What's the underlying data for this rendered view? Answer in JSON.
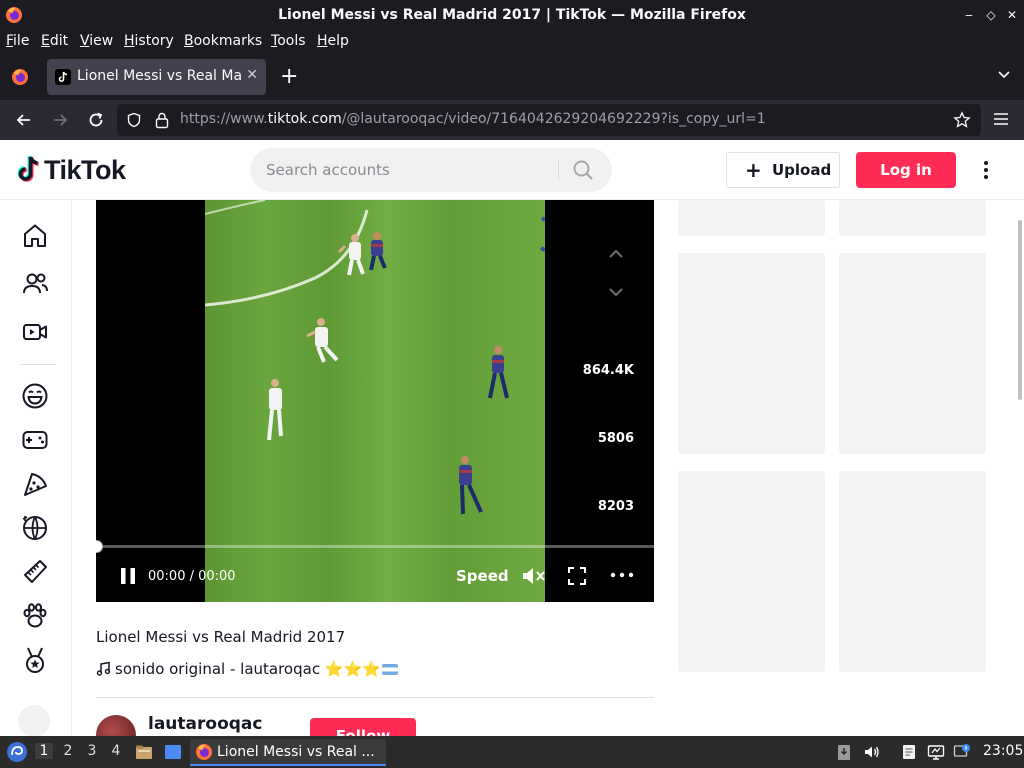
{
  "window": {
    "title": "Lionel Messi vs Real Madrid 2017 | TikTok — Mozilla Firefox",
    "controls": {
      "minimize": "‒",
      "restore": "◇",
      "close": "✕"
    }
  },
  "menubar": {
    "items": [
      {
        "label": "File",
        "accel": "F"
      },
      {
        "label": "Edit",
        "accel": "E"
      },
      {
        "label": "View",
        "accel": "V"
      },
      {
        "label": "History",
        "accel": "H"
      },
      {
        "label": "Bookmarks",
        "accel": "B"
      },
      {
        "label": "Tools",
        "accel": "T"
      },
      {
        "label": "Help",
        "accel": "H"
      }
    ]
  },
  "tabs": [
    {
      "title": "Lionel Messi vs Real Madrid 2017 | TikTok",
      "close": "✕"
    }
  ],
  "newtab_label": "+",
  "urlbar": {
    "prefix": "https://www.",
    "domain": "tiktok.com",
    "path": "/@lautarooqac/video/7164042629204692229?is_copy_url=1"
  },
  "tiktok": {
    "logo_text": "TikTok",
    "search_placeholder": "Search accounts",
    "upload_label": "Upload",
    "upload_plus": "+",
    "login_label": "Log in"
  },
  "sidebar": {
    "icons": [
      "home-icon",
      "following-icon",
      "live-icon",
      "comedy-icon",
      "gaming-icon",
      "food-icon",
      "dance-icon",
      "beauty-icon",
      "animals-icon",
      "sports-icon"
    ]
  },
  "player": {
    "stats": {
      "likes": "864.4K",
      "comments": "5806",
      "shares": "8203"
    },
    "time": "00:00 / 00:00",
    "speed_label": "Speed",
    "progress": 0
  },
  "video": {
    "description": "Lionel Messi vs Real Madrid 2017",
    "music": "sonido original - lautaroqac",
    "music_stars": "⭐⭐⭐"
  },
  "author": {
    "username": "lautarooqac",
    "follow_label": "Follow"
  },
  "taskbar": {
    "workspaces": [
      "1",
      "2",
      "3",
      "4"
    ],
    "active_workspace": "1",
    "task_label": "Lionel Messi vs Real ...",
    "clock": "23:05"
  },
  "colors": {
    "brand": "#fe2c55",
    "firefox_dark": "#1c1b22",
    "toolbar": "#2b2a33"
  }
}
